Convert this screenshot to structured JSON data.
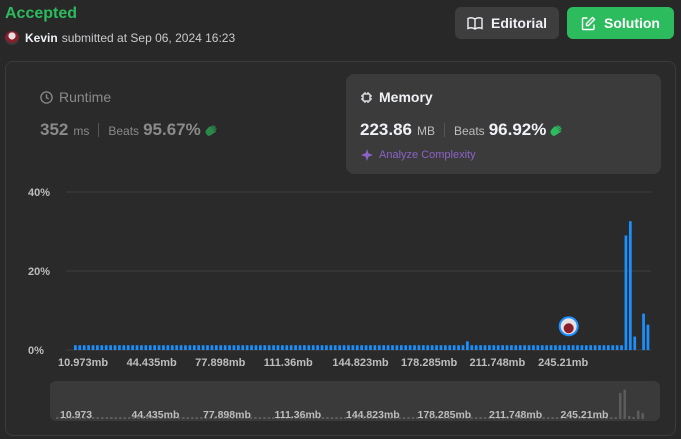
{
  "status": "Accepted",
  "submitter": {
    "name": "Kevin",
    "text": "submitted at Sep 06, 2024 16:23"
  },
  "buttons": {
    "editorial": "Editorial",
    "solution": "Solution"
  },
  "runtime": {
    "title": "Runtime",
    "value": "352",
    "unit": "ms",
    "beats_label": "Beats",
    "beats_pct": "95.67%"
  },
  "memory": {
    "title": "Memory",
    "value": "223.86",
    "unit": "MB",
    "beats_label": "Beats",
    "beats_pct": "96.92%",
    "analyze_label": "Analyze Complexity"
  },
  "colors": {
    "accepted": "#2cbb5d",
    "bar": "#1a90ff",
    "muted_bar": "#5c5c5c",
    "accent_purple": "#8b63c7"
  },
  "icons": {
    "editorial": "book-icon",
    "solution": "edit-icon",
    "runtime": "clock-icon",
    "memory": "chip-icon",
    "beats": "clapping-hands-icon",
    "analyze": "sparkle-icon"
  },
  "chart_data": {
    "type": "bar",
    "title": "",
    "xlabel": "",
    "ylabel": "",
    "ylim": [
      0,
      40
    ],
    "y_ticks": [
      "40%",
      "20%",
      "0%"
    ],
    "x_ticks": [
      "10.973mb",
      "44.435mb",
      "77.898mb",
      "111.36mb",
      "144.823mb",
      "178.285mb",
      "211.748mb",
      "245.21mb"
    ],
    "range_ticks": [
      "10.973",
      "44.435mb",
      "77.898mb",
      "111.36mb",
      "144.823mb",
      "178.285mb",
      "211.748mb",
      "245.21mb"
    ],
    "grid": true,
    "values": [
      1.2,
      1.2,
      1.2,
      1.2,
      1.2,
      1.2,
      1.2,
      1.2,
      1.2,
      1.2,
      1.2,
      1.2,
      1.2,
      1.2,
      1.2,
      1.2,
      1.2,
      1.2,
      1.2,
      1.2,
      1.2,
      1.2,
      1.2,
      1.2,
      1.2,
      1.2,
      1.2,
      1.2,
      1.2,
      1.2,
      1.2,
      1.2,
      1.2,
      1.2,
      1.2,
      1.2,
      1.2,
      1.2,
      1.2,
      1.2,
      1.2,
      1.2,
      1.2,
      1.2,
      1.2,
      1.2,
      1.2,
      1.2,
      1.2,
      1.2,
      1.2,
      1.2,
      1.2,
      1.2,
      1.2,
      1.2,
      1.2,
      1.2,
      1.2,
      1.2,
      1.2,
      1.2,
      1.2,
      1.2,
      1.2,
      1.2,
      1.2,
      1.2,
      1.2,
      1.2,
      1.2,
      1.2,
      1.2,
      1.2,
      1.2,
      1.2,
      1.2,
      1.2,
      1.2,
      1.2,
      1.2,
      1.2,
      1.2,
      1.2,
      1.2,
      1.2,
      1.2,
      1.2,
      1.2,
      2.2,
      1.2,
      1.2,
      1.2,
      1.2,
      1.2,
      1.2,
      1.2,
      1.2,
      1.2,
      1.2,
      1.2,
      1.2,
      1.2,
      1.2,
      1.2,
      1.2,
      1.2,
      1.2,
      1.2,
      1.2,
      1.2,
      1.2,
      1.2,
      1.2,
      1.2,
      1.2,
      1.2,
      1.2,
      1.2,
      1.2,
      1.2,
      1.2,
      1.2,
      1.2,
      1.2,
      29.0,
      32.6,
      3.4,
      0,
      9.2,
      6.4
    ],
    "highlight_index": 112
  }
}
